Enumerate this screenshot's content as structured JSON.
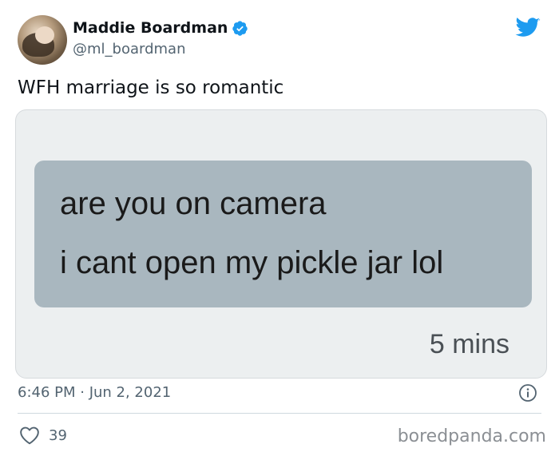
{
  "author": {
    "display_name": "Maddie Boardman",
    "handle": "@ml_boardman"
  },
  "tweet": {
    "text": "WFH marriage is so romantic",
    "timestamp": "6:46 PM · Jun 2, 2021",
    "like_count": "39"
  },
  "media": {
    "message_lines": [
      "are you on camera",
      "i cant open my pickle jar lol"
    ],
    "message_time": "5 mins"
  },
  "watermark": "boredpanda.com",
  "icons": {
    "verified": "verified-badge-icon",
    "brand": "twitter-bird-icon",
    "info": "info-icon",
    "like": "heart-icon"
  },
  "colors": {
    "brand": "#1d9bf0",
    "bubble": "#a9b7bf",
    "secondary_text": "#536471"
  }
}
